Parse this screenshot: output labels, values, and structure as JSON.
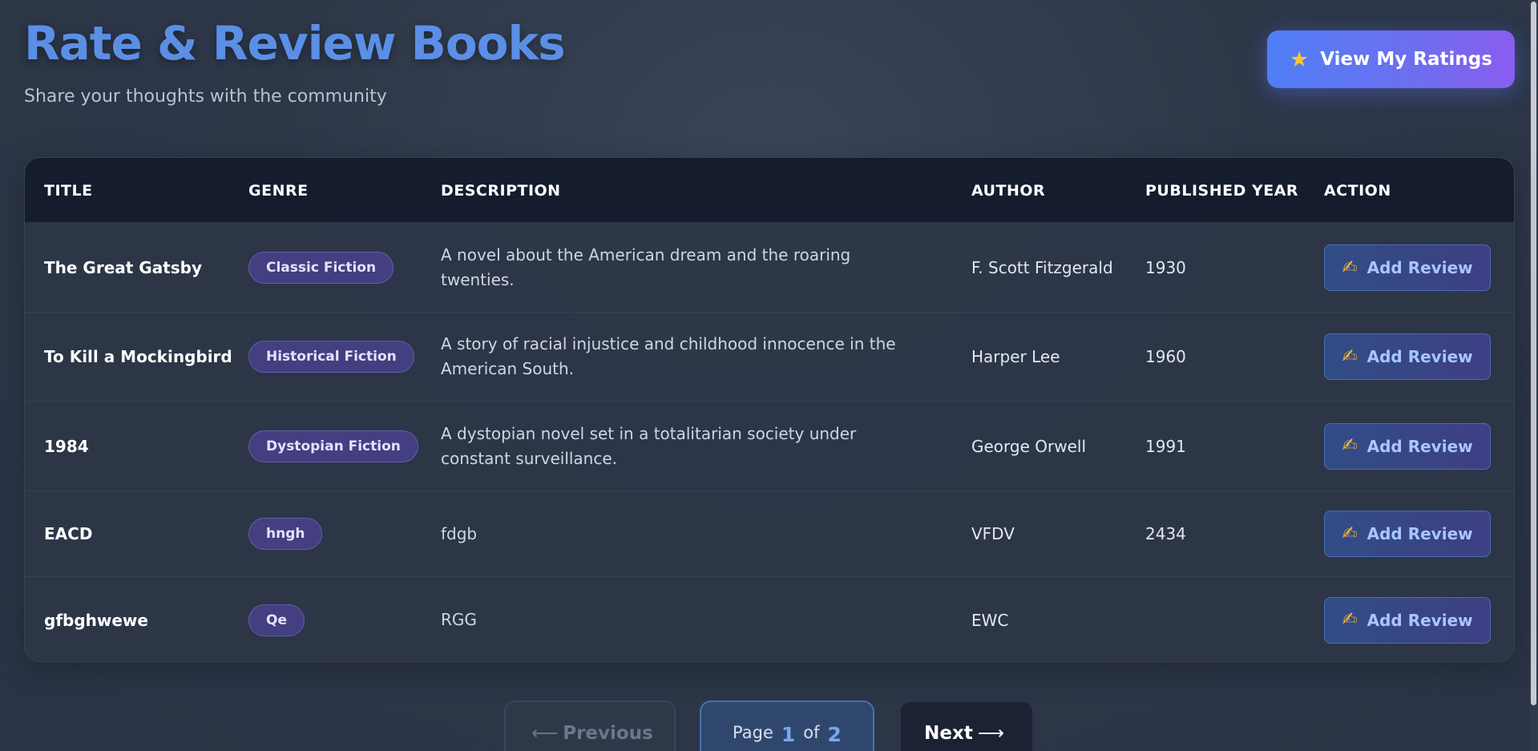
{
  "header": {
    "title": "Rate & Review Books",
    "subtitle": "Share your thoughts with the community",
    "view_ratings": {
      "icon": "star-icon",
      "label": "View My Ratings"
    }
  },
  "table": {
    "columns": [
      "TITLE",
      "GENRE",
      "DESCRIPTION",
      "AUTHOR",
      "PUBLISHED YEAR",
      "ACTION"
    ],
    "rows": [
      {
        "title": "The Great Gatsby",
        "genre": "Classic Fiction",
        "description": "A novel about the American dream and the roaring twenties.",
        "author": "F. Scott Fitzgerald",
        "year": "1930",
        "action": "Add Review"
      },
      {
        "title": "To Kill a Mockingbird",
        "genre": "Historical Fiction",
        "description": "A story of racial injustice and childhood innocence in the American South.",
        "author": "Harper Lee",
        "year": "1960",
        "action": "Add Review"
      },
      {
        "title": "1984",
        "genre": "Dystopian Fiction",
        "description": "A dystopian novel set in a totalitarian society under constant surveillance.",
        "author": "George Orwell",
        "year": "1991",
        "action": "Add Review"
      },
      {
        "title": "EACD",
        "genre": "hngh",
        "description": "fdgb",
        "author": "VFDV",
        "year": "2434",
        "action": "Add Review"
      },
      {
        "title": "gfbghwewe",
        "genre": "Qe",
        "description": "RGG",
        "author": "EWC",
        "year": "",
        "action": "Add Review"
      }
    ],
    "action_icon": "writing-hand-icon"
  },
  "pagination": {
    "previous": "Previous",
    "next": "Next",
    "page_word": "Page",
    "of_word": "of",
    "current_page": "1",
    "total_pages": "2"
  },
  "colors": {
    "accent": "#5b8fe6",
    "badge_bg": "#443f80",
    "header_bg": "#141c2e"
  }
}
